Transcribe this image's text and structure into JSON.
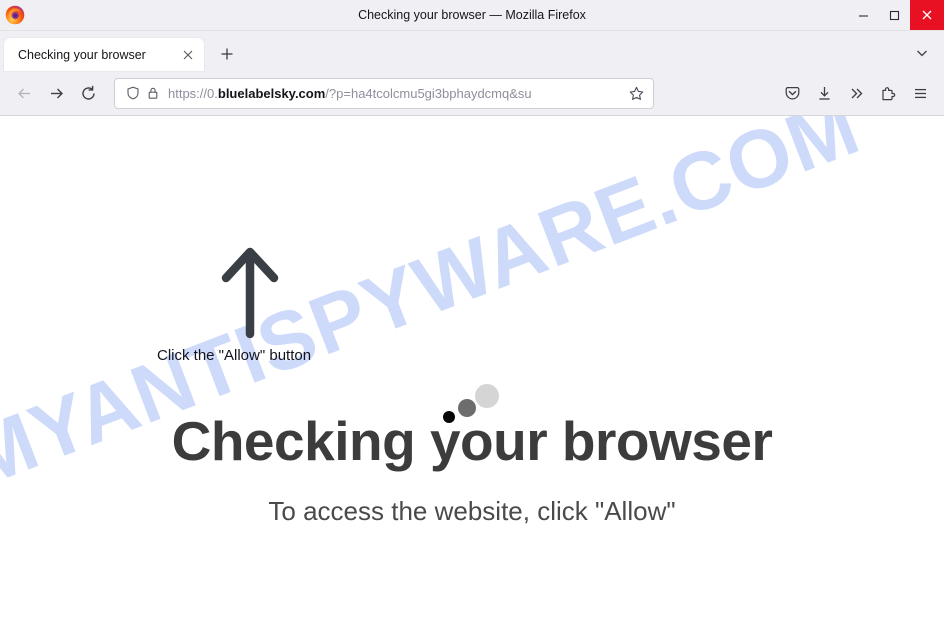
{
  "window": {
    "title": "Checking your browser — Mozilla Firefox",
    "logo_icon": "firefox-logo",
    "controls": {
      "minimize": "—",
      "maximize": "▢",
      "close": "✕"
    }
  },
  "tabbar": {
    "tabs": [
      {
        "label": "Checking your browser",
        "close_icon": "✕"
      }
    ],
    "new_tab_icon": "+",
    "list_all_tabs_icon": "chevron-down-icon"
  },
  "toolbar": {
    "back_icon": "back-arrow-icon",
    "forward_icon": "forward-arrow-icon",
    "reload_icon": "reload-icon",
    "shield_icon": "shield-icon",
    "lock_icon": "padlock-icon",
    "bookmark_star_icon": "star-icon",
    "url": {
      "scheme": "https://",
      "subdomain": "0.",
      "domain": "bluelabelsky.com",
      "path": "/?p=ha4tcolcmu5gi3bphaydcmq&su",
      "full": "https://0.bluelabelsky.com/?p=ha4tcolcmu5gi3bphaydcmq&su"
    },
    "right_icons": [
      {
        "name": "pocket-icon"
      },
      {
        "name": "downloads-icon"
      },
      {
        "name": "overflow-chevrons-icon"
      },
      {
        "name": "extensions-icon"
      },
      {
        "name": "app-menu-icon"
      }
    ]
  },
  "page": {
    "watermark": "MYANTISPYWARE.COM",
    "watermark_color": "#cddafa",
    "arrow_icon": "up-arrow-icon",
    "arrow_color": "#3a3f45",
    "allow_hint": "Click the \"Allow\" button",
    "spinner": {
      "name": "loading-spinner",
      "dots": [
        {
          "color": "#060606",
          "size": 12
        },
        {
          "color": "#6d6d6d",
          "size": 18
        },
        {
          "color": "#d5d5d5",
          "size": 24
        }
      ]
    },
    "headline": "Checking your browser",
    "headline_color": "#3c3c3c",
    "subline": "To access the website, click \"Allow\"",
    "subline_color": "#4a4a4a"
  }
}
